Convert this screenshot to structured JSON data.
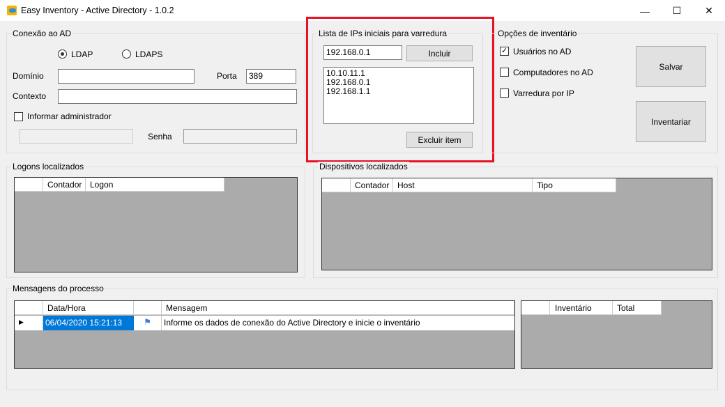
{
  "window": {
    "title": "Easy Inventory - Active Directory - 1.0.2",
    "minimize": "—",
    "maximize": "☐",
    "close": "✕"
  },
  "connection": {
    "title": "Conexão ao AD",
    "ldap": "LDAP",
    "ldaps": "LDAPS",
    "ldap_selected": true,
    "domain_label": "Domínio",
    "domain_value": "",
    "port_label": "Porta",
    "port_value": "389",
    "context_label": "Contexto",
    "context_value": "",
    "admin_label": "Informar administrador",
    "admin_checked": false,
    "password_label": "Senha"
  },
  "ip_list": {
    "title": "Lista de IPs iniciais para varredura",
    "input_value": "192.168.0.1",
    "add_label": "Incluir",
    "items": [
      "10.10.11.1",
      "192.168.0.1",
      "192.168.1.1"
    ],
    "remove_label": "Excluir item",
    "highlight_color": "#e81123"
  },
  "options": {
    "title": "Opções de inventário",
    "items": [
      {
        "label": "Usuários no AD",
        "checked": true
      },
      {
        "label": "Computadores no AD",
        "checked": false
      },
      {
        "label": "Varredura por IP",
        "checked": false
      }
    ],
    "save_label": "Salvar",
    "inventory_label": "Inventariar"
  },
  "logons": {
    "title": "Logons localizados",
    "columns": [
      "Contador",
      "Logon"
    ]
  },
  "devices": {
    "title": "Dispositivos localizados",
    "columns": [
      "Contador",
      "Host",
      "Tipo"
    ]
  },
  "messages": {
    "title": "Mensagens do processo",
    "columns": [
      "Data/Hora",
      "",
      "Mensagem"
    ],
    "rows": [
      {
        "datetime": "06/04/2020 15:21:13",
        "icon": "info-flag-icon",
        "message": "Informe os dados de conexão do Active Directory e inicie o inventário"
      }
    ],
    "selection_color": "#0078d7"
  },
  "summary": {
    "columns": [
      "Inventário",
      "Total"
    ]
  }
}
